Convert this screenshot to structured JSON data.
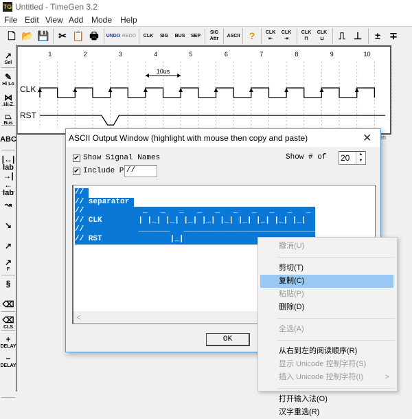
{
  "app": {
    "title": "Untitled - TimeGen 3.2",
    "icon_label": "TG"
  },
  "menu": [
    "File",
    "Edit",
    "View",
    "Add",
    "Mode",
    "Help"
  ],
  "toolbar": [
    {
      "name": "new",
      "label": "🗋"
    },
    {
      "name": "open",
      "label": "📂"
    },
    {
      "name": "save",
      "label": "💾"
    },
    {
      "name": "cut",
      "label": "✂"
    },
    {
      "name": "paste",
      "label": "📋"
    },
    {
      "name": "print",
      "label": "🖶"
    },
    {
      "name": "undo",
      "label": "UNDO"
    },
    {
      "name": "redo",
      "label": "REDO"
    },
    {
      "name": "clk",
      "label": "CLK"
    },
    {
      "name": "sig",
      "label": "SIG"
    },
    {
      "name": "bus",
      "label": "BUS"
    },
    {
      "name": "sep",
      "label": "SEP"
    },
    {
      "name": "sig-attr",
      "label": "SIG Attr"
    },
    {
      "name": "ascii",
      "label": "ASCII"
    },
    {
      "name": "help",
      "label": "?"
    },
    {
      "name": "clk-left",
      "label": "CLK ⇤"
    },
    {
      "name": "clk-right",
      "label": "CLK ⇥"
    },
    {
      "name": "clk-a",
      "label": "CLK ⊓"
    },
    {
      "name": "clk-b",
      "label": "CLK ⊔"
    },
    {
      "name": "edge-rise",
      "label": "⎍"
    },
    {
      "name": "edge-fall",
      "label": "⊥"
    },
    {
      "name": "space-add",
      "label": "±"
    },
    {
      "name": "space-del",
      "label": "∓"
    }
  ],
  "left_tools": [
    {
      "name": "sel",
      "label": "Sel",
      "glyph": "↗"
    },
    {
      "name": "hi-lo",
      "label": "Hi Lo",
      "glyph": "✎"
    },
    {
      "name": "hi-z",
      "label": "Hi-Z",
      "glyph": "⋈"
    },
    {
      "name": "bus",
      "label": "Bus",
      "glyph": "⏢"
    },
    {
      "name": "text",
      "label": "ABC",
      "glyph": ""
    },
    {
      "name": "lab-1",
      "label": "lab",
      "glyph": "|↔|"
    },
    {
      "name": "lab-2",
      "label": "lab",
      "glyph": "→|←"
    },
    {
      "name": "curve",
      "label": "",
      "glyph": "↝"
    },
    {
      "name": "line",
      "label": "",
      "glyph": "↘"
    },
    {
      "name": "arrow",
      "label": "",
      "glyph": "↗"
    },
    {
      "name": "arrow-f",
      "label": "F",
      "glyph": "↗"
    },
    {
      "name": "break",
      "label": "",
      "glyph": "§"
    },
    {
      "name": "eraser",
      "label": "",
      "glyph": "⌫"
    },
    {
      "name": "clear",
      "label": "CLS",
      "glyph": "⌫"
    },
    {
      "name": "delay-add",
      "label": "DELAY",
      "glyph": "+"
    },
    {
      "name": "delay-sub",
      "label": "DELAY",
      "glyph": "−"
    }
  ],
  "timing": {
    "cycle_numbers": [
      "1",
      "2",
      "3",
      "4",
      "5",
      "6",
      "7",
      "8",
      "9",
      "10"
    ],
    "signals": [
      {
        "name": "CLK",
        "type": "clock"
      },
      {
        "name": "RST",
        "type": "signal",
        "low_from_halfcycle": 3.5,
        "low_to_halfcycle": 4.5
      }
    ],
    "measure_label": "10us",
    "measure_from_cycle": 4,
    "measure_to_cycle": 5
  },
  "dialog": {
    "title": "ASCII Output Window (highlight with mouse then copy and paste)",
    "show_signal_names_label": "Show Signal Names",
    "show_signal_names": true,
    "include_prefix_label": "Include Pre:",
    "include_prefix": true,
    "prefix_value": "//",
    "show_count_label": "Show # of",
    "show_count": "20",
    "ascii_lines": [
      "// ",
      "// separator ",
      "//             _   _   _   _   _   _   _   _   _   _",
      "// CLK        | |_| |_| |_| |_| |_| |_| |_| |_| |_| ",
      "//            _______   ______________________________",
      "// RST               |_|                             "
    ],
    "scroll_left": "<",
    "ok_label": "OK"
  },
  "context_menu": [
    {
      "label": "撤消(U)",
      "disabled": true
    },
    {
      "sep": true
    },
    {
      "label": "剪切(T)",
      "disabled": false
    },
    {
      "label": "复制(C)",
      "disabled": false,
      "selected": true
    },
    {
      "label": "粘贴(P)",
      "disabled": true
    },
    {
      "label": "删除(D)",
      "disabled": false
    },
    {
      "sep": true
    },
    {
      "label": "全选(A)",
      "disabled": true
    },
    {
      "sep": true
    },
    {
      "label": "从右到左的阅读顺序(R)",
      "disabled": false
    },
    {
      "label": "显示 Unicode 控制字符(S)",
      "disabled": true
    },
    {
      "label": "插入 Unicode 控制字符(I)",
      "disabled": true,
      "submenu": ">"
    },
    {
      "sep": true
    },
    {
      "label": "打开输入法(O)",
      "disabled": false
    },
    {
      "label": "汉字重选(R)",
      "disabled": false
    }
  ],
  "edge_label": "en"
}
